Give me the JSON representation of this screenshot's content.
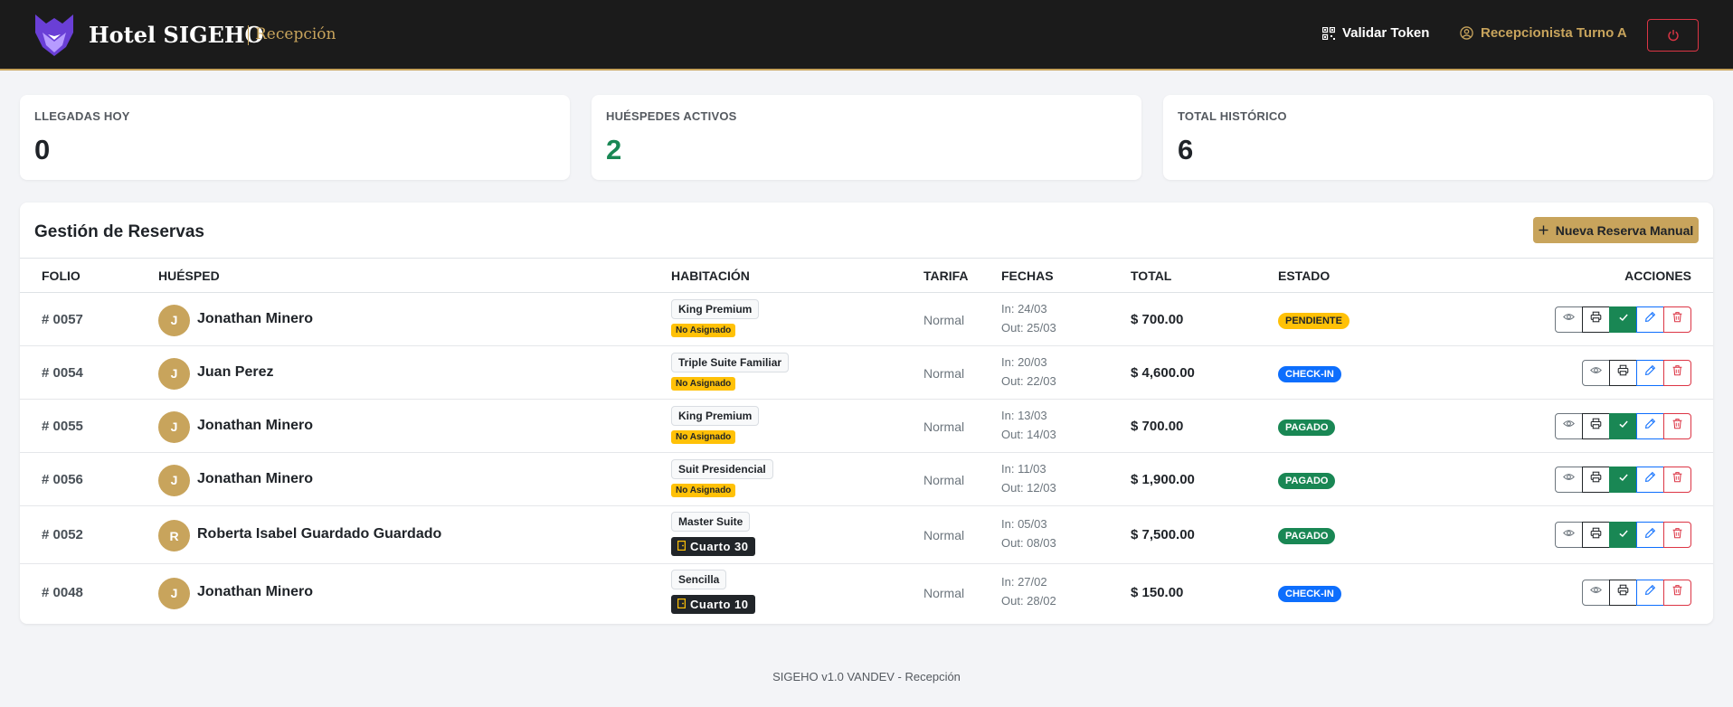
{
  "navbar": {
    "brand": "Hotel SIGEHO",
    "section": "Recepción",
    "validate_token": "Validar Token",
    "user": "Recepcionista Turno A"
  },
  "stats": [
    {
      "label": "LLEGADAS HOY",
      "value": "0",
      "color": "#1f2328"
    },
    {
      "label": "HUÉSPEDES ACTIVOS",
      "value": "2",
      "color": "#198754"
    },
    {
      "label": "TOTAL HISTÓRICO",
      "value": "6",
      "color": "#1f2328"
    }
  ],
  "panel": {
    "title": "Gestión de Reservas",
    "new_button": "Nueva Reserva Manual"
  },
  "table": {
    "headers": {
      "folio": "FOLIO",
      "guest": "HUÉSPED",
      "room": "HABITACIÓN",
      "rate": "TARIFA",
      "dates": "FECHAS",
      "total": "TOTAL",
      "status": "ESTADO",
      "actions": "ACCIONES"
    },
    "rows": [
      {
        "folio": "# 0057",
        "initial": "J",
        "guest": "Jonathan Minero",
        "room_type": "King Premium",
        "room_assign": "No Asignado",
        "rate": "Normal",
        "date_in": "In: 24/03",
        "date_out": "Out: 25/03",
        "total": "$ 700.00",
        "status": "PENDIENTE",
        "confirm_action": true
      },
      {
        "folio": "# 0054",
        "initial": "J",
        "guest": "Juan Perez",
        "room_type": "Triple Suite Familiar",
        "room_assign": "No Asignado",
        "rate": "Normal",
        "date_in": "In: 20/03",
        "date_out": "Out: 22/03",
        "total": "$ 4,600.00",
        "status": "CHECK-IN",
        "confirm_action": false
      },
      {
        "folio": "# 0055",
        "initial": "J",
        "guest": "Jonathan Minero",
        "room_type": "King Premium",
        "room_assign": "No Asignado",
        "rate": "Normal",
        "date_in": "In: 13/03",
        "date_out": "Out: 14/03",
        "total": "$ 700.00",
        "status": "PAGADO",
        "confirm_action": true
      },
      {
        "folio": "# 0056",
        "initial": "J",
        "guest": "Jonathan Minero",
        "room_type": "Suit Presidencial",
        "room_assign": "No Asignado",
        "rate": "Normal",
        "date_in": "In: 11/03",
        "date_out": "Out: 12/03",
        "total": "$ 1,900.00",
        "status": "PAGADO",
        "confirm_action": true
      },
      {
        "folio": "# 0052",
        "initial": "R",
        "guest": "Roberta Isabel Guardado Guardado",
        "room_type": "Master Suite",
        "room_number": "Cuarto 30",
        "rate": "Normal",
        "date_in": "In: 05/03",
        "date_out": "Out: 08/03",
        "total": "$ 7,500.00",
        "status": "PAGADO",
        "confirm_action": true
      },
      {
        "folio": "# 0048",
        "initial": "J",
        "guest": "Jonathan Minero",
        "room_type": "Sencilla",
        "room_number": "Cuarto 10",
        "rate": "Normal",
        "date_in": "In: 27/02",
        "date_out": "Out: 28/02",
        "total": "$ 150.00",
        "status": "CHECK-IN",
        "confirm_action": false
      }
    ]
  },
  "status_colors": {
    "PENDIENTE": {
      "bg": "#ffc107",
      "fg": "#1f2328"
    },
    "CHECK-IN": {
      "bg": "#0d6efd",
      "fg": "#ffffff"
    },
    "PAGADO": {
      "bg": "#198754",
      "fg": "#ffffff"
    }
  },
  "icons": {
    "brand": "fox-logo-icon",
    "token": "qr-code-icon",
    "user": "user-circle-icon",
    "logout": "power-icon",
    "new": "plus-icon",
    "view": "eye-icon",
    "print": "printer-icon",
    "confirm": "check-icon",
    "edit": "pencil-icon",
    "delete": "trash-icon",
    "door": "door-icon"
  },
  "footer": "SIGEHO v1.0 VANDEV - Recepción"
}
